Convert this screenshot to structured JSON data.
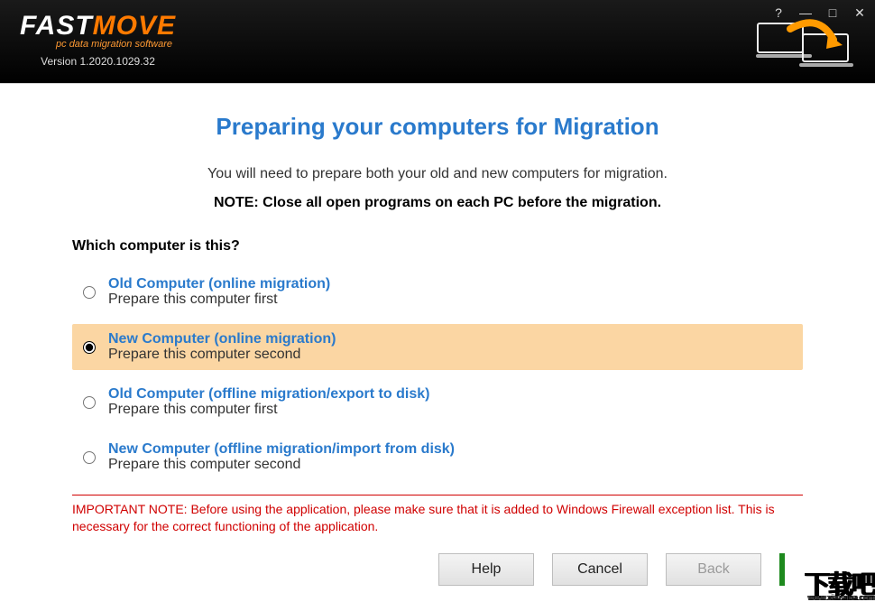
{
  "header": {
    "brand1": "FAST",
    "brand2": "MOVE",
    "tagline": "pc data migration software",
    "version": "Version 1.2020.1029.32"
  },
  "page": {
    "title": "Preparing your computers for Migration",
    "intro": "You will need to prepare both your old and new computers for migration.",
    "note": "NOTE: Close all open programs on each PC before the migration.",
    "question": "Which computer is this?",
    "options": [
      {
        "title": "Old Computer (online migration)",
        "sub": "Prepare this computer first",
        "selected": false
      },
      {
        "title": "New Computer (online migration)",
        "sub": "Prepare this computer second",
        "selected": true
      },
      {
        "title": "Old Computer (offline migration/export to disk)",
        "sub": "Prepare this computer first",
        "selected": false
      },
      {
        "title": "New Computer (offline migration/import from disk)",
        "sub": "Prepare this computer second",
        "selected": false
      }
    ],
    "warning": "IMPORTANT NOTE: Before using the application, please make sure that it is added to Windows Firewall exception list. This is necessary for the correct functioning of the application."
  },
  "footer": {
    "help": "Help",
    "cancel": "Cancel",
    "back": "Back"
  },
  "watermark": {
    "main": "下载吧",
    "sub": "www.xiazaiba.com"
  }
}
